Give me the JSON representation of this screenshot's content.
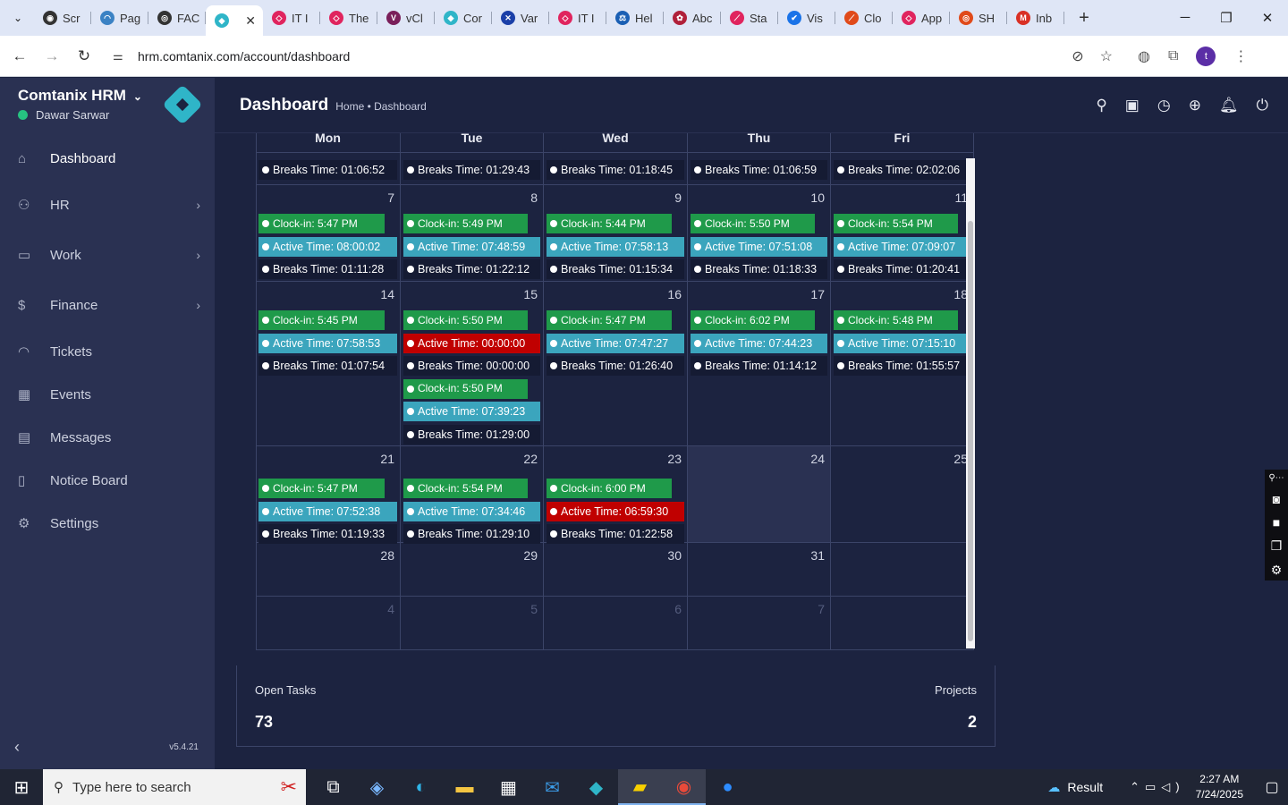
{
  "browser": {
    "tabs": [
      {
        "label": "Scr",
        "color": "#333333",
        "glyph": "◉"
      },
      {
        "label": "Pag",
        "color": "#3b82c4",
        "glyph": "◠"
      },
      {
        "label": "FAC",
        "color": "#333333",
        "glyph": "◎"
      },
      {
        "label": "",
        "color": "#2fb5c8",
        "glyph": "◆",
        "active": true
      },
      {
        "label": "IT I",
        "color": "#e0245e",
        "glyph": "◇"
      },
      {
        "label": "The",
        "color": "#e0245e",
        "glyph": "◇"
      },
      {
        "label": "vCl",
        "color": "#7a1f5a",
        "glyph": "V"
      },
      {
        "label": "Cor",
        "color": "#2fb5c8",
        "glyph": "◆"
      },
      {
        "label": "Var",
        "color": "#1a3fa8",
        "glyph": "✕"
      },
      {
        "label": "IT I",
        "color": "#e0245e",
        "glyph": "◇"
      },
      {
        "label": "Hel",
        "color": "#1a5fb4",
        "glyph": "⚖"
      },
      {
        "label": "Abc",
        "color": "#b0203a",
        "glyph": "✿"
      },
      {
        "label": "Sta",
        "color": "#e0245e",
        "glyph": "⟋"
      },
      {
        "label": "Vis",
        "color": "#1a73e8",
        "glyph": "✔"
      },
      {
        "label": "Clo",
        "color": "#e04a1a",
        "glyph": "⟋"
      },
      {
        "label": "App",
        "color": "#e0245e",
        "glyph": "◇"
      },
      {
        "label": "SH",
        "color": "#e04a1a",
        "glyph": "◎"
      },
      {
        "label": "Inb",
        "color": "#d93025",
        "glyph": "M"
      }
    ],
    "url": "hrm.comtanix.com/account/dashboard"
  },
  "sidebar": {
    "brand": "Comtanix HRM",
    "user": "Dawar Sarwar",
    "version": "v5.4.21",
    "items": [
      {
        "label": "Dashboard",
        "icon": "⌂",
        "arrow": false,
        "active": true
      },
      {
        "label": "HR",
        "icon": "⚇",
        "arrow": true
      },
      {
        "label": "Work",
        "icon": "▭",
        "arrow": true
      },
      {
        "label": "Finance",
        "icon": "$",
        "arrow": true
      },
      {
        "label": "Tickets",
        "icon": "◠",
        "arrow": false
      },
      {
        "label": "Events",
        "icon": "▦",
        "arrow": false
      },
      {
        "label": "Messages",
        "icon": "▤",
        "arrow": false
      },
      {
        "label": "Notice Board",
        "icon": "▯",
        "arrow": false
      },
      {
        "label": "Settings",
        "icon": "⚙",
        "arrow": false
      }
    ]
  },
  "header": {
    "title": "Dashboard",
    "breadcrumb": "Home • Dashboard"
  },
  "calendar": {
    "days": [
      "Mon",
      "Tue",
      "Wed",
      "Thu",
      "Fri"
    ],
    "weeks": [
      {
        "cells": [
          {
            "events": [
              {
                "t": "brk",
                "text": "Breaks Time: 01:06:52"
              }
            ]
          },
          {
            "events": [
              {
                "t": "brk",
                "text": "Breaks Time: 01:29:43"
              }
            ]
          },
          {
            "events": [
              {
                "t": "brk",
                "text": "Breaks Time: 01:18:45"
              }
            ]
          },
          {
            "events": [
              {
                "t": "brk",
                "text": "Breaks Time: 01:06:59"
              }
            ]
          },
          {
            "events": [
              {
                "t": "brk",
                "text": "Breaks Time: 02:02:06"
              }
            ]
          }
        ]
      },
      {
        "cells": [
          {
            "day": "7",
            "events": [
              {
                "t": "clock",
                "text": "Clock-in: 5:47 PM"
              },
              {
                "t": "active",
                "text": "Active Time: 08:00:02"
              },
              {
                "t": "brk",
                "text": "Breaks Time: 01:11:28"
              }
            ]
          },
          {
            "day": "8",
            "events": [
              {
                "t": "clock",
                "text": "Clock-in: 5:49 PM"
              },
              {
                "t": "active",
                "text": "Active Time: 07:48:59"
              },
              {
                "t": "brk",
                "text": "Breaks Time: 01:22:12"
              }
            ]
          },
          {
            "day": "9",
            "events": [
              {
                "t": "clock",
                "text": "Clock-in: 5:44 PM"
              },
              {
                "t": "active",
                "text": "Active Time: 07:58:13"
              },
              {
                "t": "brk",
                "text": "Breaks Time: 01:15:34"
              }
            ]
          },
          {
            "day": "10",
            "events": [
              {
                "t": "clock",
                "text": "Clock-in: 5:50 PM"
              },
              {
                "t": "active",
                "text": "Active Time: 07:51:08"
              },
              {
                "t": "brk",
                "text": "Breaks Time: 01:18:33"
              }
            ]
          },
          {
            "day": "11",
            "events": [
              {
                "t": "clock",
                "text": "Clock-in: 5:54 PM"
              },
              {
                "t": "active",
                "text": "Active Time: 07:09:07"
              },
              {
                "t": "brk",
                "text": "Breaks Time: 01:20:41"
              }
            ]
          }
        ]
      },
      {
        "cells": [
          {
            "day": "14",
            "events": [
              {
                "t": "clock",
                "text": "Clock-in: 5:45 PM"
              },
              {
                "t": "active",
                "text": "Active Time: 07:58:53"
              },
              {
                "t": "brk",
                "text": "Breaks Time: 01:07:54"
              }
            ]
          },
          {
            "day": "15",
            "events": [
              {
                "t": "clock",
                "text": "Clock-in: 5:50 PM"
              },
              {
                "t": "alert",
                "text": "Active Time: 00:00:00"
              },
              {
                "t": "brk",
                "text": "Breaks Time: 00:00:00"
              },
              {
                "t": "clock",
                "text": "Clock-in: 5:50 PM"
              },
              {
                "t": "active",
                "text": "Active Time: 07:39:23"
              },
              {
                "t": "brk",
                "text": "Breaks Time: 01:29:00"
              }
            ]
          },
          {
            "day": "16",
            "events": [
              {
                "t": "clock",
                "text": "Clock-in: 5:47 PM"
              },
              {
                "t": "active",
                "text": "Active Time: 07:47:27"
              },
              {
                "t": "brk",
                "text": "Breaks Time: 01:26:40"
              }
            ]
          },
          {
            "day": "17",
            "events": [
              {
                "t": "clock",
                "text": "Clock-in: 6:02 PM"
              },
              {
                "t": "active",
                "text": "Active Time: 07:44:23"
              },
              {
                "t": "brk",
                "text": "Breaks Time: 01:14:12"
              }
            ]
          },
          {
            "day": "18",
            "events": [
              {
                "t": "clock",
                "text": "Clock-in: 5:48 PM"
              },
              {
                "t": "active",
                "text": "Active Time: 07:15:10"
              },
              {
                "t": "brk",
                "text": "Breaks Time: 01:55:57"
              }
            ]
          }
        ]
      },
      {
        "cells": [
          {
            "day": "21",
            "events": [
              {
                "t": "clock",
                "text": "Clock-in: 5:47 PM"
              },
              {
                "t": "active",
                "text": "Active Time: 07:52:38"
              },
              {
                "t": "brk",
                "text": "Breaks Time: 01:19:33"
              }
            ]
          },
          {
            "day": "22",
            "events": [
              {
                "t": "clock",
                "text": "Clock-in: 5:54 PM"
              },
              {
                "t": "active",
                "text": "Active Time: 07:34:46"
              },
              {
                "t": "brk",
                "text": "Breaks Time: 01:29:10"
              }
            ]
          },
          {
            "day": "23",
            "events": [
              {
                "t": "clock",
                "text": "Clock-in: 6:00 PM"
              },
              {
                "t": "alert",
                "text": "Active Time: 06:59:30"
              },
              {
                "t": "brk",
                "text": "Breaks Time: 01:22:58"
              }
            ]
          },
          {
            "day": "24",
            "today": true,
            "events": []
          },
          {
            "day": "25",
            "events": []
          }
        ]
      },
      {
        "cells": [
          {
            "day": "28",
            "events": []
          },
          {
            "day": "29",
            "events": []
          },
          {
            "day": "30",
            "events": []
          },
          {
            "day": "31",
            "events": []
          },
          {
            "day": "",
            "events": []
          }
        ]
      },
      {
        "cells": [
          {
            "day": "4",
            "other": true,
            "events": []
          },
          {
            "day": "5",
            "other": true,
            "events": []
          },
          {
            "day": "6",
            "other": true,
            "events": []
          },
          {
            "day": "7",
            "other": true,
            "events": []
          },
          {
            "day": "",
            "other": true,
            "events": []
          }
        ]
      }
    ]
  },
  "stats": {
    "open_tasks_label": "Open Tasks",
    "open_tasks_value": "73",
    "projects_label": "Projects",
    "projects_value": "2"
  },
  "taskbar": {
    "search_placeholder": "Type here to search",
    "weather": "Result",
    "time": "2:27 AM",
    "date": "7/24/2025"
  }
}
